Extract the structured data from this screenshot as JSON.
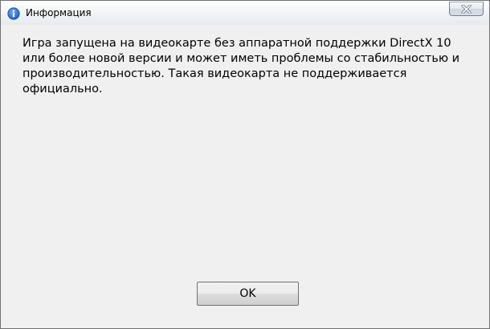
{
  "window": {
    "title": "Информация",
    "icon": "info-icon"
  },
  "titlebar": {
    "close_icon": "close-icon"
  },
  "message": {
    "text": "Игра запущена на видеокарте без аппаратной поддержки DirectX 10 или более новой версии и может иметь проблемы со стабильностью и производительностью. Такая видеокарта не поддерживается официально."
  },
  "buttons": {
    "ok_label": "OK"
  },
  "colors": {
    "info_icon": "#1f5fc0",
    "close_glyph": "#ffffff",
    "window_bg": "#f0f0f0"
  }
}
